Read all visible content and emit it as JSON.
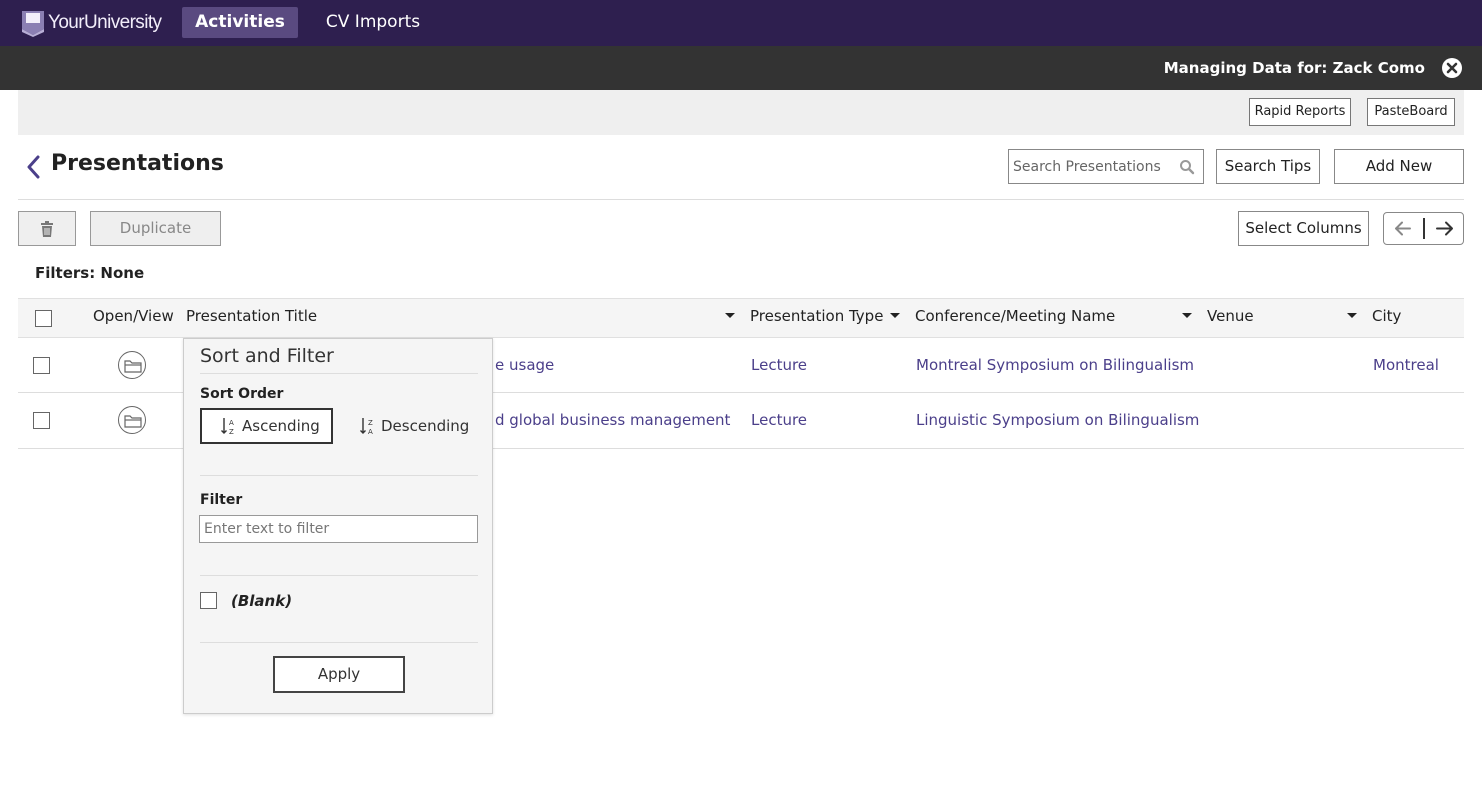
{
  "nav": {
    "logo_text": "YourUniversity",
    "tabs": [
      {
        "label": "Activities",
        "active": true
      },
      {
        "label": "CV Imports",
        "active": false
      }
    ]
  },
  "manage_bar": {
    "text": "Managing Data for: Zack Como"
  },
  "toolbar": {
    "rapid_reports": "Rapid Reports",
    "pasteboard": "PasteBoard"
  },
  "page": {
    "title": "Presentations",
    "search_placeholder": "Search Presentations",
    "search_tips": "Search Tips",
    "add_new": "Add New"
  },
  "actions": {
    "duplicate": "Duplicate",
    "select_columns": "Select Columns"
  },
  "filters_label": "Filters: None",
  "table": {
    "columns": [
      "Open/View",
      "Presentation Title",
      "Presentation Type",
      "Conference/Meeting Name",
      "Venue",
      "City"
    ],
    "rows": [
      {
        "title_visible": "e usage",
        "type": "Lecture",
        "conference": "Montreal Symposium on Bilingualism",
        "venue": "",
        "city": "Montreal"
      },
      {
        "title_visible": "d global business management",
        "type": "Lecture",
        "conference": "Linguistic Symposium on Bilingualism",
        "venue": "",
        "city": ""
      }
    ]
  },
  "popup": {
    "title": "Sort and Filter",
    "sort_order_label": "Sort Order",
    "ascending": "Ascending",
    "descending": "Descending",
    "filter_label": "Filter",
    "filter_placeholder": "Enter text to filter",
    "blank_option": "(Blank)",
    "apply": "Apply"
  },
  "colors": {
    "nav_bg": "#2e1f4f",
    "nav_active": "#5a4a80",
    "manage_bg": "#333333",
    "link": "#4b3f8a"
  }
}
